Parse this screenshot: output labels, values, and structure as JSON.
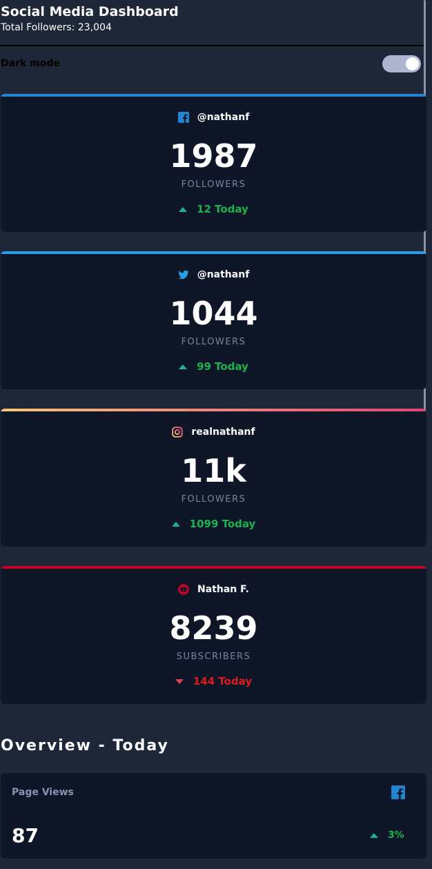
{
  "header": {
    "title": "Social Media Dashboard",
    "total_followers": "Total Followers: 23,004"
  },
  "dark_mode": {
    "label": "Dark mode",
    "enabled": true
  },
  "cards": [
    {
      "platform": "facebook",
      "icon": "facebook-icon",
      "handle": "@nathanf",
      "count": "1987",
      "label": "FOLLOWERS",
      "change": "12 Today",
      "direction": "up",
      "color": "#2185d0"
    },
    {
      "platform": "twitter",
      "icon": "twitter-icon",
      "handle": "@nathanf",
      "count": "1044",
      "label": "FOLLOWERS",
      "change": "99 Today",
      "direction": "up",
      "color": "#2a9fe8"
    },
    {
      "platform": "instagram",
      "icon": "instagram-icon",
      "handle": "realnathanf",
      "count": "11k",
      "label": "FOLLOWERS",
      "change": "1099 Today",
      "direction": "up",
      "color": "#e2457a"
    },
    {
      "platform": "youtube",
      "icon": "youtube-icon",
      "handle": "Nathan F.",
      "count": "8239",
      "label": "SUBSCRIBERS",
      "change": "144 Today",
      "direction": "down",
      "color": "#c4032b"
    }
  ],
  "overview": {
    "title": "Overview - Today",
    "items": [
      {
        "label": "Page Views",
        "icon": "facebook-icon",
        "value": "87",
        "change": "3%",
        "direction": "up"
      }
    ]
  },
  "colors": {
    "background": "#1e2738",
    "card": "#0f1628",
    "up": "#1db34f",
    "down": "#dc1d1d",
    "muted": "#7c83a0"
  }
}
